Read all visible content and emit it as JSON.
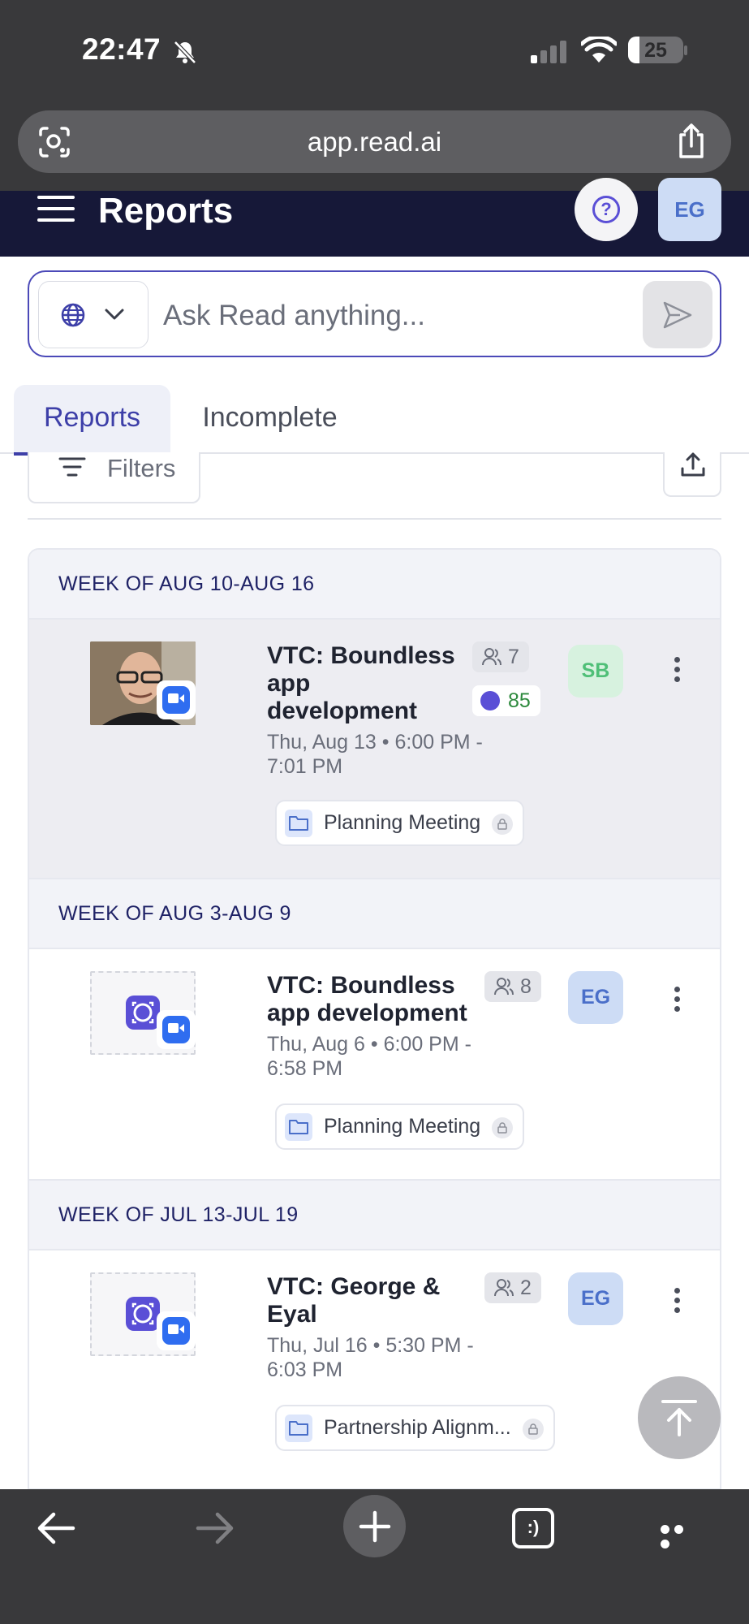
{
  "status_bar": {
    "time": "22:47",
    "battery": "25"
  },
  "browser": {
    "url": "app.read.ai"
  },
  "header": {
    "title": "Reports",
    "user_initials": "EG"
  },
  "ask": {
    "placeholder": "Ask Read anything..."
  },
  "tabs": [
    {
      "label": "Reports",
      "active": true
    },
    {
      "label": "Incomplete",
      "active": false
    }
  ],
  "toolbar": {
    "filters_label": "Filters"
  },
  "weeks": [
    {
      "label": "WEEK OF AUG 10-AUG 16",
      "reports": [
        {
          "title_lines": [
            "VTC: Boundless",
            "app",
            "development"
          ],
          "time_lines": [
            "Thu, Aug 13 • 6:00 PM -",
            "7:01 PM"
          ],
          "participants": "7",
          "score": "85",
          "owner": "SB",
          "tag": "Planning Meeting"
        }
      ]
    },
    {
      "label": "WEEK OF AUG 3-AUG 9",
      "reports": [
        {
          "title_lines": [
            "VTC: Boundless",
            "app development"
          ],
          "time_lines": [
            "Thu, Aug 6 • 6:00 PM -",
            "6:58 PM"
          ],
          "participants": "8",
          "owner": "EG",
          "tag": "Planning Meeting"
        }
      ]
    },
    {
      "label": "WEEK OF JUL 13-JUL 19",
      "reports": [
        {
          "title_lines": [
            "VTC: George &",
            "Eyal"
          ],
          "time_lines": [
            "Thu, Jul 16 • 5:30 PM -",
            "6:03 PM"
          ],
          "participants": "2",
          "owner": "EG",
          "tag": "Partnership Alignm..."
        }
      ]
    }
  ],
  "bottom_toolbar": {
    "tabs_glyph": ":)"
  },
  "colors": {
    "brand_dark": "#161838",
    "accent": "#3d3fa8",
    "zoom_blue": "#2f6df0",
    "score_green": "#2e8a3e"
  }
}
